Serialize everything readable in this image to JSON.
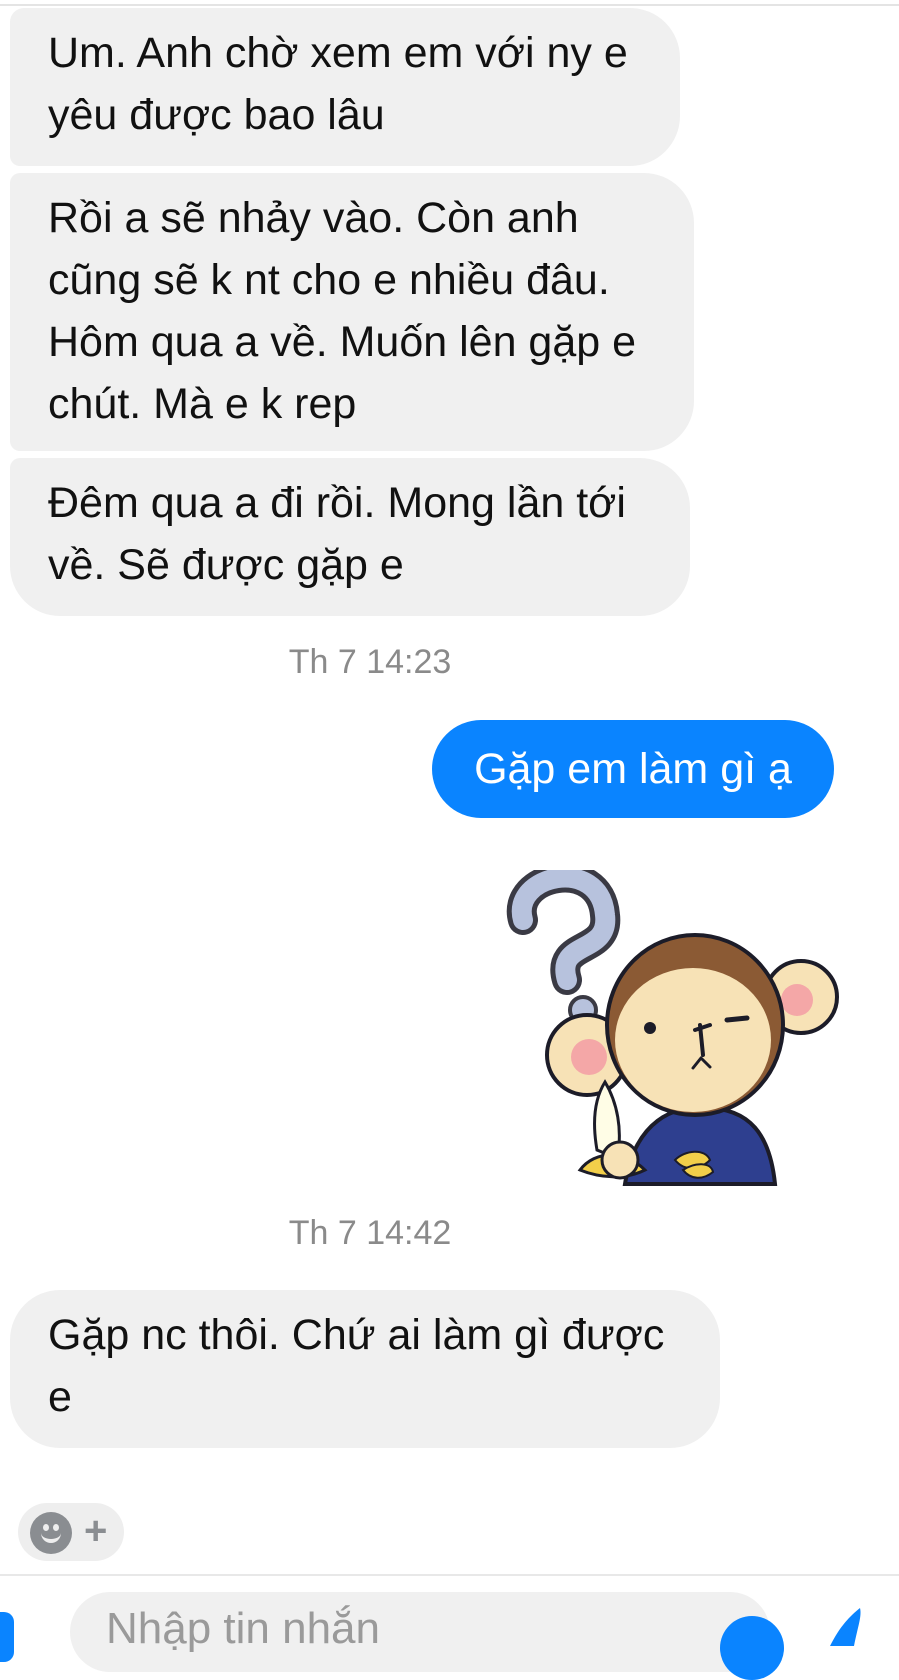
{
  "messages": {
    "m1": {
      "lines": [
        "Um. Anh chờ xem em với ny e",
        "yêu được bao lâu"
      ]
    },
    "m2": {
      "lines": [
        "Rồi a sẽ nhảy vào. Còn anh",
        "cũng sẽ k nt cho e nhiều đâu.",
        "Hôm qua a về. Muốn lên gặp e",
        "chút. Mà e k rep"
      ]
    },
    "m3": {
      "lines": [
        "Đêm qua a đi rồi. Mong lần tới",
        "về. Sẽ được gặp e"
      ]
    },
    "ts1": "Th 7 14:23",
    "m4": {
      "lines": [
        "Gặp em làm gì ạ"
      ]
    },
    "sticker": {
      "icon": "monkey-question-sticker"
    },
    "ts2": "Th 7 14:42",
    "m5": {
      "lines": [
        "Gặp nc thôi. Chứ ai làm gì được",
        "e"
      ]
    }
  },
  "reactions": {
    "emoji_icon": "smiley-icon",
    "add_label": "+"
  },
  "composer": {
    "placeholder": "Nhập tin nhắn"
  },
  "colors": {
    "outgoing": "#0a84ff",
    "incoming": "#f0f0f0",
    "timestamp": "#8a8a8a"
  }
}
